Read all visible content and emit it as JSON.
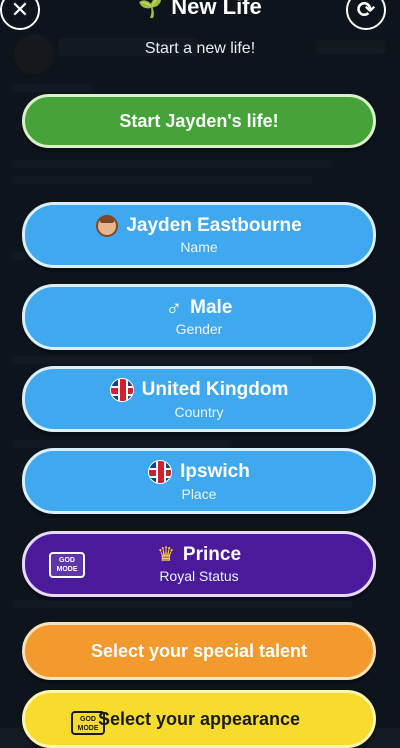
{
  "header": {
    "title": "New Life",
    "subtitle": "Start a new life!"
  },
  "start_button": {
    "label": "Start Jayden's life!"
  },
  "options": [
    {
      "id": "name",
      "value": "Jayden Eastbourne",
      "caption": "Name",
      "icon": "face-icon"
    },
    {
      "id": "gender",
      "value": "Male",
      "caption": "Gender",
      "icon": "male-symbol-icon"
    },
    {
      "id": "country",
      "value": "United Kingdom",
      "caption": "Country",
      "icon": "uk-flag-icon"
    },
    {
      "id": "place",
      "value": "Ipswich",
      "caption": "Place",
      "icon": "uk-flag-icon"
    },
    {
      "id": "royal",
      "value": "Prince",
      "caption": "Royal Status",
      "icon": "crown-icon",
      "badge": "GOD MODE"
    }
  ],
  "talent_button": {
    "label": "Select your special talent"
  },
  "appearance_button": {
    "label": "Select your appearance",
    "badge": "GOD MODE"
  },
  "colors": {
    "start": "#46a33a",
    "option": "#3fa8ef",
    "royal": "#4a1a9a",
    "talent": "#f29a2e",
    "appearance": "#f7dc2d"
  }
}
